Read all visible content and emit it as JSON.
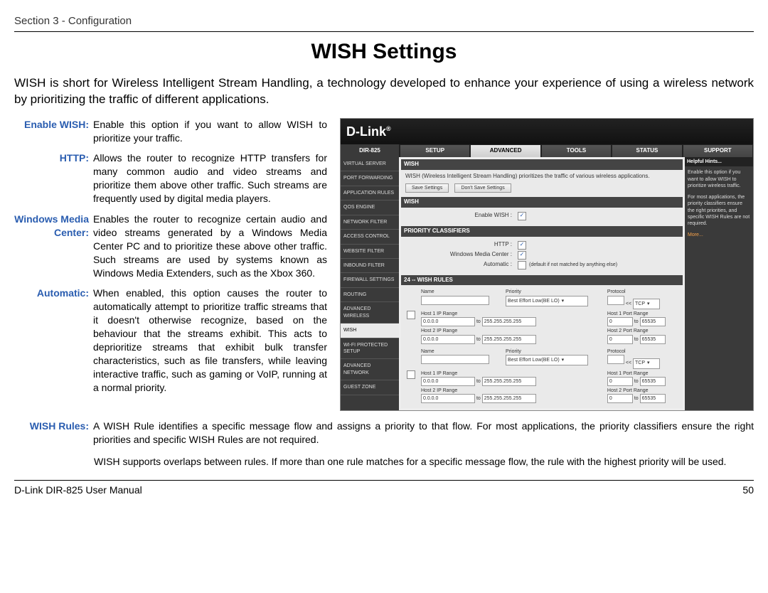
{
  "header": "Section 3 - Configuration",
  "title": "WISH Settings",
  "intro": "WISH is short for Wireless Intelligent Stream Handling, a technology developed to enhance your experience of using a wireless network by prioritizing the traffic of different applications.",
  "definitions": [
    {
      "term": "Enable WISH:",
      "desc": "Enable this option if you want to allow WISH to prioritize your traffic."
    },
    {
      "term": "HTTP:",
      "desc": "Allows the router to recognize HTTP transfers for many common audio and video streams and prioritize them above other traffic. Such streams are frequently used by digital media players."
    },
    {
      "term": "Windows Media Center:",
      "desc": "Enables the router to recognize certain audio and video streams generated by a Windows Media Center PC and to prioritize these above other traffic. Such streams are used by systems known as Windows Media Extenders, such as the Xbox 360."
    },
    {
      "term": "Automatic:",
      "desc": "When enabled, this option causes the router to automatically attempt to prioritize traffic streams that it doesn't otherwise recognize, based on the behaviour that the streams exhibit. This acts to deprioritize streams that exhibit bulk transfer characteristics, such as file transfers, while leaving interactive traffic, such as gaming or VoIP, running at a normal priority."
    }
  ],
  "wideDef": {
    "term": "WISH Rules:",
    "desc": "A WISH Rule identifies a specific message flow and assigns a priority to that flow. For most applications, the priority classifiers ensure the right priorities and specific WISH Rules are not required.",
    "extra": "WISH supports overlaps between rules. If more than one rule matches for a specific message flow, the rule with the highest priority will be used."
  },
  "footer": {
    "left": "D-Link DIR-825 User Manual",
    "right": "50"
  },
  "router": {
    "brand": "D-Link",
    "model": "DIR-825",
    "mainTabs": [
      "SETUP",
      "ADVANCED",
      "TOOLS",
      "STATUS",
      "SUPPORT"
    ],
    "activeMainTab": "ADVANCED",
    "sidebar": [
      "VIRTUAL SERVER",
      "PORT FORWARDING",
      "APPLICATION RULES",
      "QOS ENGINE",
      "NETWORK FILTER",
      "ACCESS CONTROL",
      "WEBSITE FILTER",
      "INBOUND FILTER",
      "FIREWALL SETTINGS",
      "ROUTING",
      "ADVANCED WIRELESS",
      "WISH",
      "WI-FI PROTECTED SETUP",
      "ADVANCED NETWORK",
      "GUEST ZONE"
    ],
    "activeSide": "WISH",
    "hints": {
      "title": "Helpful Hints...",
      "body1": "Enable this option if you want to allow WISH to prioritize wireless traffic.",
      "body2": "For most applications, the priority classifiers ensure the right priorities, and specific WISH Rules are not required.",
      "more": "More..."
    },
    "panels": {
      "introTitle": "WISH",
      "introText": "WISH (Wireless Intelligent Stream Handling) prioritizes the traffic of various wireless applications.",
      "saveBtn": "Save Settings",
      "dontSaveBtn": "Don't Save Settings",
      "wishTitle": "WISH",
      "enableLabel": "Enable WISH :",
      "prioTitle": "PRIORITY CLASSIFIERS",
      "httpLabel": "HTTP :",
      "wmcLabel": "Windows Media Center :",
      "autoLabel": "Automatic :",
      "autoNote": "(default if not matched by anything else)",
      "rulesTitle": "24 -- WISH RULES",
      "tableHeaders": {
        "name": "Name",
        "priority": "Priority",
        "protocol": "Protocol",
        "h1ip": "Host 1 IP Range",
        "h1port": "Host 1 Port Range",
        "h2ip": "Host 2 IP Range",
        "h2port": "Host 2 Port Range"
      },
      "defaults": {
        "prioritySel": "Best Effort Low(BE LO)",
        "protoSel": "TCP",
        "ipFrom": "0.0.0.0",
        "ipTo": "255.255.255.255",
        "portFrom": "0",
        "portTo": "65535",
        "to": "to",
        "lsh": "<<"
      }
    }
  }
}
